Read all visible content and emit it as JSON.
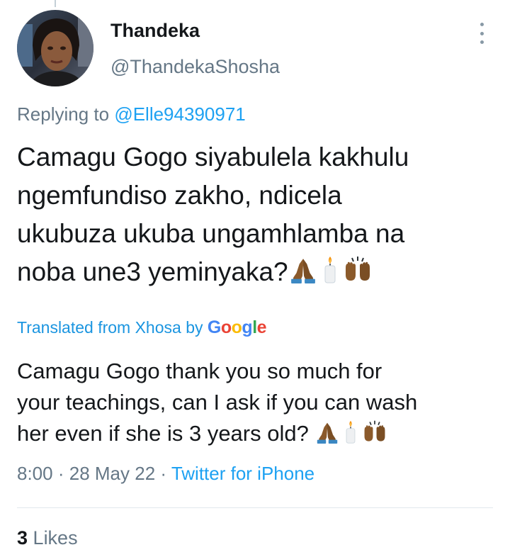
{
  "tweet": {
    "author": {
      "display_name": "Thandeka",
      "handle": "@ThandekaShosha"
    },
    "reply": {
      "prefix": "Replying to",
      "mention": "@Elle94390971"
    },
    "text_lines": [
      "Camagu Gogo siyabulela kakhulu",
      "ngemfundiso zakho, ndicela",
      "ukubuza ukuba ungamhlamba na",
      "noba une3 yeminyaka?"
    ],
    "translation": {
      "label": "Translated from Xhosa",
      "by": "by",
      "provider_letters": [
        "G",
        "o",
        "o",
        "g",
        "l",
        "e"
      ],
      "text_lines": [
        "Camagu Gogo thank you so much for",
        "your teachings, can I ask if you can wash",
        "her even if she is 3 years old?"
      ]
    },
    "emojis": [
      "folded-hands-icon",
      "candle-icon",
      "raising-hands-icon"
    ],
    "meta": {
      "time": "8:00",
      "separator": "·",
      "date": "28 May 22",
      "source": "Twitter for iPhone"
    },
    "stats": {
      "likes_count": "3",
      "likes_label": "Likes"
    }
  },
  "colors": {
    "text_primary": "#14171a",
    "text_secondary": "#657786",
    "link": "#1da1f2",
    "divider": "#e1e8ed",
    "emoji_skin": "#8b5a2b"
  }
}
